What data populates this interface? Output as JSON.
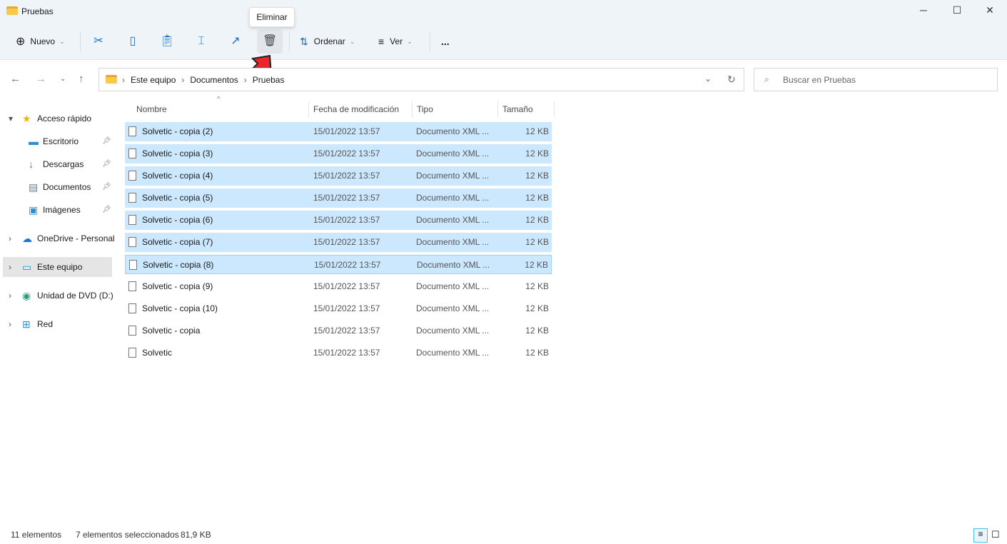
{
  "window": {
    "title": "Pruebas"
  },
  "toolbar": {
    "new_label": "Nuevo",
    "sort_label": "Ordenar",
    "view_label": "Ver",
    "more_label": "...",
    "tooltip": "Eliminar",
    "icons": [
      "cut-icon",
      "copy-icon",
      "paste-icon",
      "rename-icon",
      "share-icon",
      "delete-icon"
    ]
  },
  "address": {
    "segments": [
      "Este equipo",
      "Documentos",
      "Pruebas"
    ]
  },
  "search": {
    "placeholder": "Buscar en Pruebas"
  },
  "sidebar": {
    "items": [
      {
        "label": "Acceso rápido",
        "icon": "star-icon"
      },
      {
        "label": "Escritorio",
        "icon": "desktop-icon"
      },
      {
        "label": "Descargas",
        "icon": "download-icon"
      },
      {
        "label": "Documentos",
        "icon": "documents-icon"
      },
      {
        "label": "Imágenes",
        "icon": "images-icon"
      },
      {
        "label": "OneDrive - Personal",
        "icon": "cloud-icon"
      },
      {
        "label": "Este equipo",
        "icon": "pc-icon"
      },
      {
        "label": "Unidad de DVD (D:)",
        "icon": "dvd-icon"
      },
      {
        "label": "Red",
        "icon": "network-icon"
      }
    ]
  },
  "columns": [
    "Nombre",
    "Fecha de modificación",
    "Tipo",
    "Tamaño"
  ],
  "files": [
    {
      "name": "Solvetic - copia (2)",
      "date": "15/01/2022 13:57",
      "type": "Documento XML ...",
      "size": "12 KB",
      "selected": true
    },
    {
      "name": "Solvetic - copia (3)",
      "date": "15/01/2022 13:57",
      "type": "Documento XML ...",
      "size": "12 KB",
      "selected": true
    },
    {
      "name": "Solvetic - copia (4)",
      "date": "15/01/2022 13:57",
      "type": "Documento XML ...",
      "size": "12 KB",
      "selected": true
    },
    {
      "name": "Solvetic - copia (5)",
      "date": "15/01/2022 13:57",
      "type": "Documento XML ...",
      "size": "12 KB",
      "selected": true
    },
    {
      "name": "Solvetic - copia (6)",
      "date": "15/01/2022 13:57",
      "type": "Documento XML ...",
      "size": "12 KB",
      "selected": true
    },
    {
      "name": "Solvetic - copia (7)",
      "date": "15/01/2022 13:57",
      "type": "Documento XML ...",
      "size": "12 KB",
      "selected": true
    },
    {
      "name": "Solvetic - copia (8)",
      "date": "15/01/2022 13:57",
      "type": "Documento XML ...",
      "size": "12 KB",
      "selected": true
    },
    {
      "name": "Solvetic - copia (9)",
      "date": "15/01/2022 13:57",
      "type": "Documento XML ...",
      "size": "12 KB",
      "selected": false
    },
    {
      "name": "Solvetic - copia (10)",
      "date": "15/01/2022 13:57",
      "type": "Documento XML ...",
      "size": "12 KB",
      "selected": false
    },
    {
      "name": "Solvetic - copia",
      "date": "15/01/2022 13:57",
      "type": "Documento XML ...",
      "size": "12 KB",
      "selected": false
    },
    {
      "name": "Solvetic",
      "date": "15/01/2022 13:57",
      "type": "Documento XML ...",
      "size": "12 KB",
      "selected": false
    }
  ],
  "status": {
    "count": "11 elementos",
    "selected": "7 elementos seleccionados",
    "size": "81,9 KB"
  }
}
